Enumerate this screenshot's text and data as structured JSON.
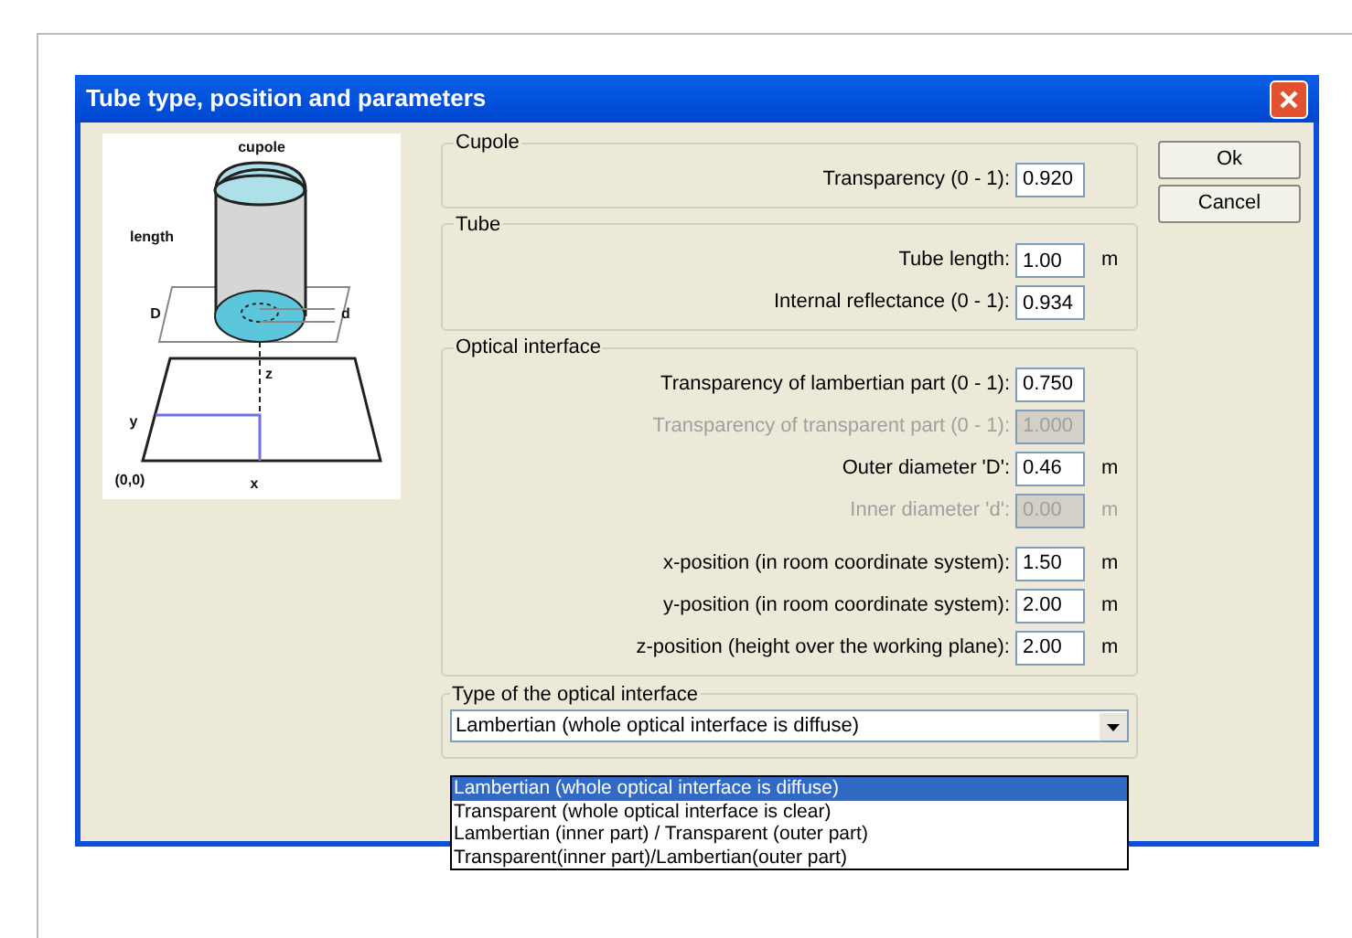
{
  "window": {
    "title": "Tube type, position and parameters"
  },
  "diagram": {
    "labels": [
      "cupole",
      "length",
      "D",
      "d",
      "z",
      "y",
      "(0,0)",
      "x"
    ]
  },
  "groups": [
    {
      "title": "Cupole",
      "row_groups": [
        [
          {
            "label": "Transparency (0 - 1):",
            "value": "0.920",
            "disabled": false
          }
        ]
      ]
    },
    {
      "title": "Tube",
      "row_groups": [
        [
          {
            "label": "Tube length:",
            "value": "1.00",
            "unit": "m",
            "disabled": false
          },
          {
            "label": "Internal reflectance (0 - 1):",
            "value": "0.934",
            "disabled": false
          }
        ]
      ]
    },
    {
      "title": "Optical interface",
      "row_groups": [
        [
          {
            "label": "Transparency of lambertian part (0 - 1):",
            "value": "0.750",
            "disabled": false
          },
          {
            "label": "Transparency of transparent part (0 - 1):",
            "value": "1.000",
            "disabled": true
          },
          {
            "label": "Outer diameter 'D':",
            "value": "0.46",
            "unit": "m",
            "disabled": false
          },
          {
            "label": "Inner diameter 'd':",
            "value": "0.00",
            "unit": "m",
            "disabled": true
          }
        ],
        [
          {
            "label": "x-position (in room coordinate system):",
            "value": "1.50",
            "unit": "m",
            "disabled": false
          },
          {
            "label": "y-position (in room coordinate system):",
            "value": "2.00",
            "unit": "m",
            "disabled": false
          },
          {
            "label": "z-position (height over the working plane):",
            "value": "2.00",
            "unit": "m",
            "disabled": false
          }
        ]
      ]
    }
  ],
  "interface_type": {
    "title": "Type of the optical interface",
    "value": "Lambertian (whole optical interface is diffuse)",
    "options": [
      {
        "label": "Lambertian (whole optical interface is diffuse)",
        "selected": true
      },
      {
        "label": "Transparent (whole optical interface is clear)",
        "selected": false
      },
      {
        "label": "Lambertian (inner part) / Transparent (outer part)",
        "selected": false
      },
      {
        "label": "Transparent(inner part)/Lambertian(outer part)",
        "selected": false
      }
    ]
  },
  "buttons": [
    "Ok",
    "Cancel"
  ]
}
